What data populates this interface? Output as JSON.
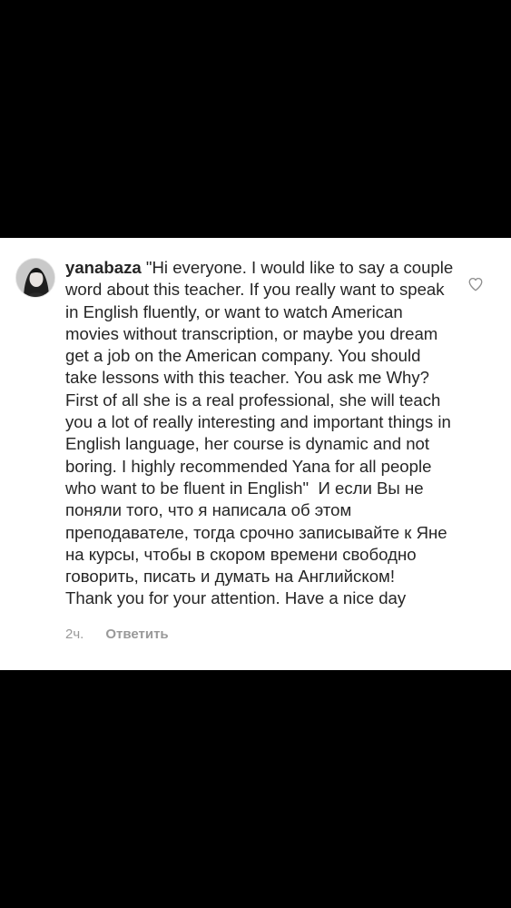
{
  "comment": {
    "username": "yanabaza",
    "body": " \"Hi everyone. I would like to say a couple word about this teacher. If you really want to speak in English fluently, or want to watch American movies without transcription, or maybe you dream get a job on the American company. You should take lessons with this teacher. You ask me Why? First of all she is a real professional, she will teach you a lot of really interesting and important things in English language, her course is dynamic and not boring. I highly recommended Yana for all people who want to be fluent in English\"  И если Вы не поняли того, что я написала об этом преподавателе, тогда срочно записывайте к Яне на курсы, чтобы в скором времени свободно говорить, писать и думать на Английском!\nThank you for your attention. Have a nice day",
    "time": "2ч.",
    "reply_label": "Ответить"
  },
  "icons": {
    "avatar": "user-avatar",
    "like": "heart-icon"
  },
  "colors": {
    "background": "#000000",
    "card": "#ffffff",
    "text": "#262626",
    "meta": "#999999"
  }
}
